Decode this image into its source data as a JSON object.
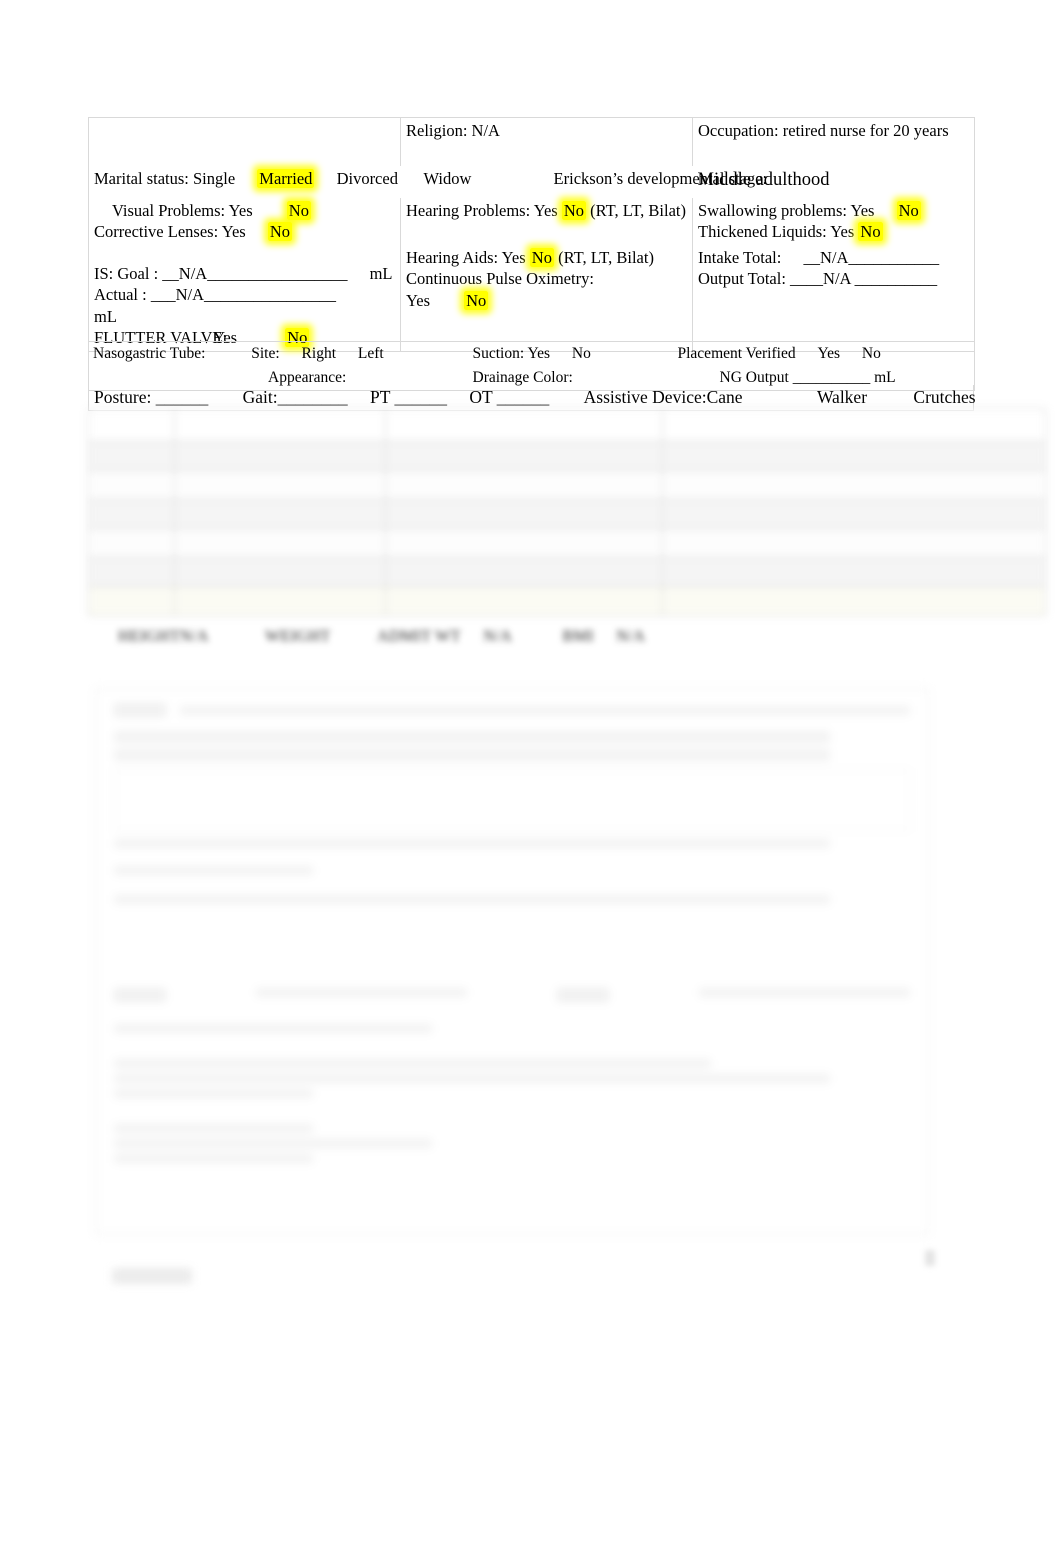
{
  "document": {
    "type": "nursing-assessment-form",
    "page_background": "#ffffff",
    "highlight_color": "#ffff00"
  },
  "form": {
    "row1": {
      "col1": "",
      "col2_label": "Religion:",
      "col2_value": "N/A",
      "col3_label": "Occupation:",
      "col3_value": "retired nurse for 20 years"
    },
    "marital": {
      "label": "Marital status:",
      "options": [
        "Single",
        "Married",
        "Divorced",
        "Widow"
      ],
      "selected": "Married"
    },
    "erickson": {
      "label": "Erickson’s developmental stage:",
      "value": "Middle adulthood"
    },
    "visual_problems": {
      "label": "Visual Problems:",
      "options": [
        "Yes",
        "No"
      ],
      "selected": "No"
    },
    "corrective_lenses": {
      "label": "Corrective Lenses:",
      "options": [
        "Yes",
        "No"
      ],
      "selected": "No"
    },
    "hearing_problems": {
      "label": "Hearing Problems:",
      "options": [
        "Yes",
        "No"
      ],
      "selected": "No",
      "suffix": "(RT, LT, Bilat)"
    },
    "hearing_aids": {
      "label": "Hearing Aids:",
      "options": [
        "Yes",
        "No"
      ],
      "selected": "No",
      "suffix": "(RT, LT, Bilat)"
    },
    "swallowing_problems": {
      "label": "Swallowing problems:",
      "options": [
        "Yes",
        "No"
      ],
      "selected": "No"
    },
    "thickened_liquids": {
      "label": "Thickened Liquids:",
      "options": [
        "Yes",
        "No"
      ],
      "selected": "No"
    },
    "is_goal": {
      "label": "IS: Goal :",
      "value": "__N/A_________________",
      "unit": "mL"
    },
    "is_actual": {
      "label": "Actual :",
      "value": "___N/A________________",
      "unit": "mL"
    },
    "flutter_valve": {
      "label": "FLUTTER VALVE:",
      "options": [
        "Yes",
        "No"
      ],
      "selected": "No"
    },
    "pulse_ox": {
      "label": "Continuous Pulse Oximetry:",
      "options": [
        "Yes",
        "No"
      ],
      "selected": "No"
    },
    "intake_total": {
      "label": "Intake Total:",
      "value": "__N/A___________"
    },
    "output_total": {
      "label": "Output Total:",
      "value": "____N/A __________"
    },
    "nasogastric": {
      "label": "Nasogastric Tube:",
      "site_label": "Site:",
      "site_options": [
        "Right",
        "Left"
      ],
      "appearance_label": "Appearance:",
      "suction_label": "Suction:",
      "suction_options": [
        "Yes",
        "No"
      ],
      "drainage_label": "Drainage Color:",
      "placement_label": "Placement Verified",
      "placement_options": [
        "Yes",
        "No"
      ],
      "ng_output_label": "NG Output",
      "ng_output_value": "__________",
      "ng_output_unit": "mL"
    },
    "mobility": {
      "posture_label": "Posture:",
      "posture_value": "______",
      "gait_label": "Gait:",
      "gait_value": "________",
      "pt_label": "PT",
      "pt_value": "______",
      "ot_label": "OT",
      "ot_value": "______",
      "assistive_label": "Assistive Device:",
      "assistive_options": [
        "Cane",
        "Walker",
        "Crutches"
      ]
    }
  },
  "vitals_blurred": {
    "note": "out-of-focus vitals table",
    "rows": [
      [
        "",
        "",
        "",
        ""
      ],
      [
        "",
        "",
        "",
        ""
      ],
      [
        "",
        "",
        "",
        ""
      ],
      [
        "",
        "",
        "",
        ""
      ],
      [
        "",
        "",
        "",
        ""
      ],
      [
        "",
        "",
        "",
        ""
      ],
      [
        "",
        "",
        "",
        ""
      ]
    ]
  },
  "measurements": {
    "height_label": "HEIGHT",
    "height_value": "N/A",
    "weight_label": "WEIGHT",
    "weight_value": "",
    "admit_wt_label": "ADMIT WT",
    "admit_wt_value": "N/A",
    "bmi_label": "BMI",
    "bmi_value": "N/A"
  },
  "lower_panel": {
    "note": "heavily blurred lower document panel, text not legible"
  }
}
